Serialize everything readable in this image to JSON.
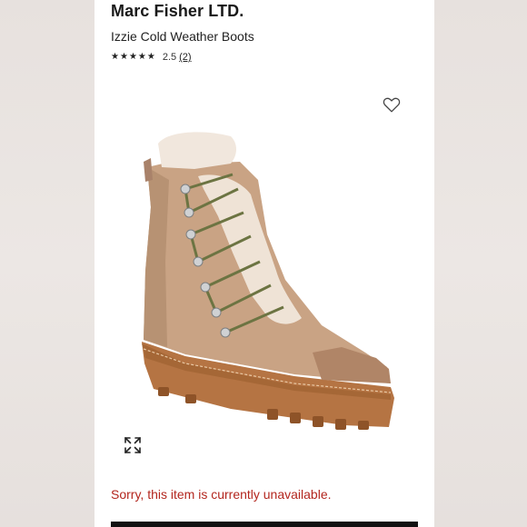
{
  "product": {
    "brand": "Marc Fisher LTD.",
    "name": "Izzie Cold Weather Boots",
    "rating": {
      "stars": [
        "★",
        "★",
        "★",
        "★",
        "★"
      ],
      "value": "2.5",
      "review_count": "(2)",
      "score": 2.5,
      "max": 5
    }
  },
  "icons": {
    "favorite": "heart-outline-icon",
    "expand": "expand-arrows-icon"
  },
  "status": {
    "message": "Sorry, this item is currently unavailable."
  },
  "colors": {
    "status_text": "#b3261e",
    "brand_text": "#1a1a1a"
  }
}
